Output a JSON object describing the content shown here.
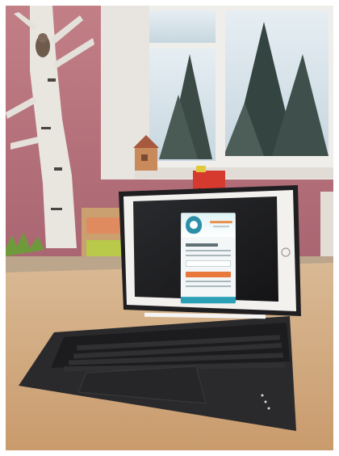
{
  "scene": {
    "subject": "tablet-with-keyboard-case",
    "setting": "classroom-table",
    "colors": {
      "wall": "#b7707a",
      "window_frame": "#f2f1ee",
      "table": "#d2ad86",
      "keyboard_case": "#2a2a2c",
      "tablet_bezel": "#f3f1ee",
      "screen_dark": "#1c1c1e",
      "app_accent": "#2a9fb5",
      "app_button": "#e9793a"
    }
  }
}
